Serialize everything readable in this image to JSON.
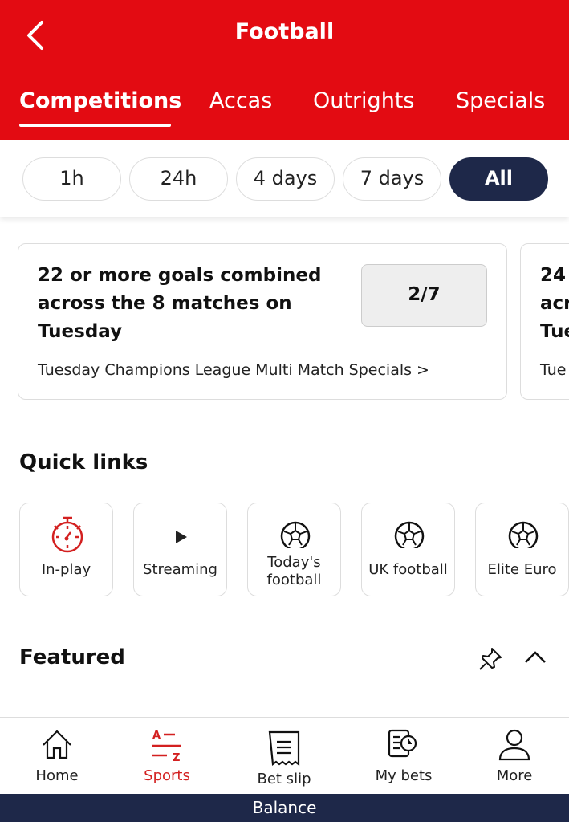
{
  "header": {
    "title": "Football",
    "tabs": [
      "Competitions",
      "Accas",
      "Outrights",
      "Specials"
    ],
    "active_tab": "Competitions"
  },
  "filters": {
    "options": [
      "1h",
      "24h",
      "4 days",
      "7 days",
      "All"
    ],
    "selected": "All"
  },
  "cards": [
    {
      "title": "22 or more goals combined across the 8 matches on Tuesday",
      "odds": "2/7",
      "subtitle": "Tuesday Champions League Multi Match Specials >"
    },
    {
      "title": "24 acr Tue",
      "subtitle": "Tue"
    }
  ],
  "quick_links": {
    "heading": "Quick links",
    "items": [
      {
        "label": "In-play",
        "icon": "stopwatch-icon"
      },
      {
        "label": "Streaming",
        "icon": "play-icon"
      },
      {
        "label": "Today's football",
        "icon": "football-icon"
      },
      {
        "label": "UK football",
        "icon": "football-icon"
      },
      {
        "label": "Elite Euro",
        "icon": "football-icon"
      }
    ]
  },
  "featured": {
    "heading": "Featured"
  },
  "bottom_nav": {
    "items": [
      "Home",
      "Sports",
      "Bet slip",
      "My bets",
      "More"
    ],
    "active": "Sports"
  },
  "balance": "Balance",
  "colors": {
    "brand_red": "#e30b12",
    "navy": "#1e2849"
  }
}
